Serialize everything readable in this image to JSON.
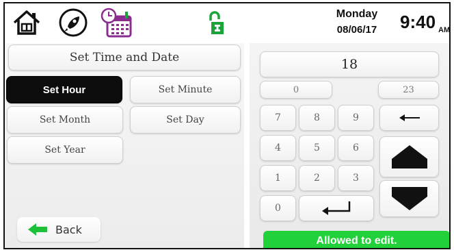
{
  "header": {
    "day": "Monday",
    "date": "08/06/17",
    "time": "9:40",
    "ampm": "AM"
  },
  "icons": {
    "home": "home-icon",
    "rocket": "rocket-icon",
    "calendar": "calendar-clock-icon",
    "lock": "unlock-icon"
  },
  "left_panel": {
    "title": "Set Time and Date",
    "buttons": [
      {
        "label": "Set Hour",
        "active": true
      },
      {
        "label": "Set Minute",
        "active": false
      },
      {
        "label": "Set Month",
        "active": false
      },
      {
        "label": "Set Day",
        "active": false
      },
      {
        "label": "Set Year",
        "active": false
      }
    ],
    "back_label": "Back"
  },
  "keypad": {
    "display_value": "18",
    "min_value": "0",
    "max_value": "23",
    "digits": [
      "7",
      "8",
      "9",
      "4",
      "5",
      "6",
      "1",
      "2",
      "3",
      "0"
    ],
    "status": "Allowed to edit."
  },
  "colors": {
    "active_button": "#0c0c0c",
    "status_green": "#22d13a",
    "back_arrow_green": "#1ec03a",
    "lock_green": "#1aa33a"
  }
}
